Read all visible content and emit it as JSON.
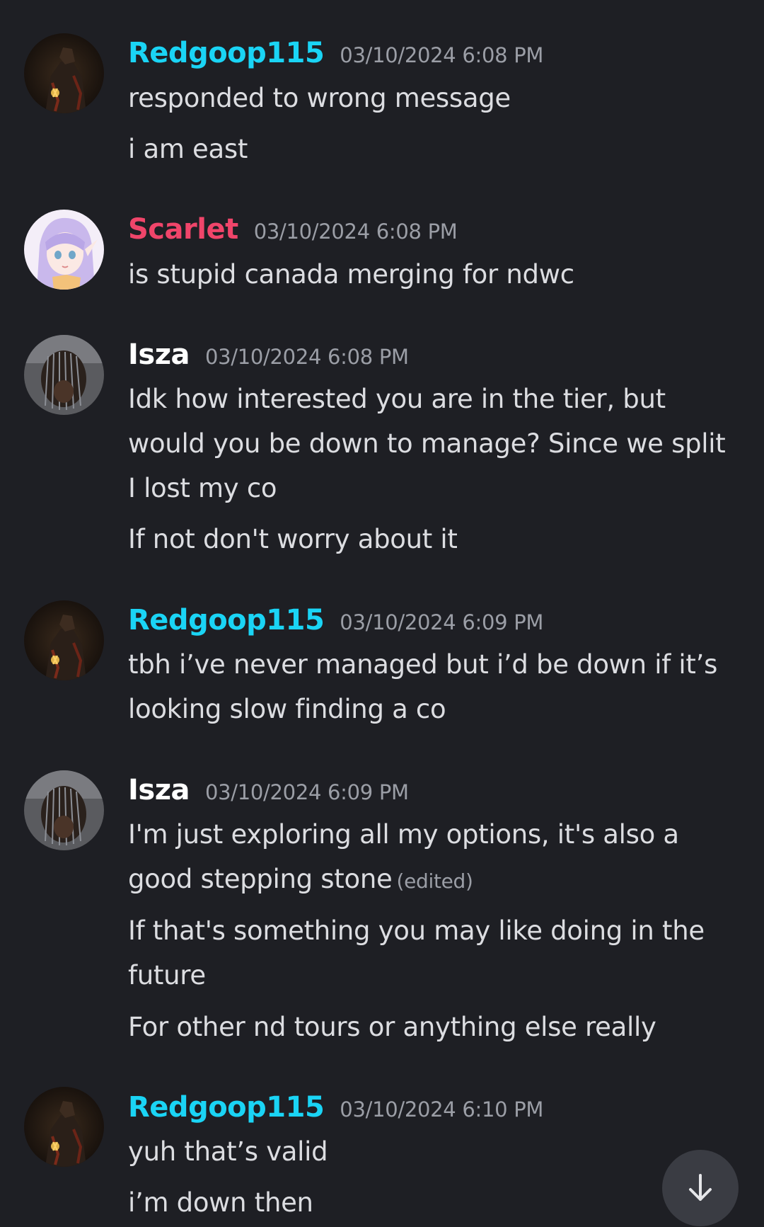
{
  "colors": {
    "background": "#1e1f24",
    "redgoop": "#1ad4f5",
    "scarlet": "#f0456a",
    "isza": "#ffffff",
    "text": "#dcdde1",
    "muted": "#9b9ea6",
    "fab": "#3a3c43"
  },
  "messages": [
    {
      "author": "Redgoop115",
      "timestamp": "03/10/2024 6:08 PM",
      "avatar": "dark-knight-avatar",
      "lines": [
        "responded to wrong message",
        "i am east"
      ]
    },
    {
      "author": "Scarlet",
      "timestamp": "03/10/2024 6:08 PM",
      "avatar": "anime-elf-avatar",
      "lines": [
        "is stupid canada merging for ndwc"
      ]
    },
    {
      "author": "Isza",
      "timestamp": "03/10/2024 6:08 PM",
      "avatar": "braids-avatar",
      "lines": [
        "Idk how interested you are in the tier, but would you be down to manage? Since we split I lost my co",
        "If not don't worry about it"
      ]
    },
    {
      "author": "Redgoop115",
      "timestamp": "03/10/2024 6:09 PM",
      "avatar": "dark-knight-avatar",
      "lines": [
        "tbh i’ve never managed but i’d be down if it’s looking slow finding a co"
      ]
    },
    {
      "author": "Isza",
      "timestamp": "03/10/2024 6:09 PM",
      "avatar": "braids-avatar",
      "lines": [
        "I'm just exploring all my options, it's also a good stepping stone",
        "If that's something you may like doing in the future",
        "For other nd tours or anything else really"
      ],
      "edited_label": "(edited)"
    },
    {
      "author": "Redgoop115",
      "timestamp": "03/10/2024 6:10 PM",
      "avatar": "dark-knight-avatar",
      "lines": [
        "yuh that’s valid",
        "i’m down then"
      ]
    }
  ],
  "scroll_button": {
    "icon": "arrow-down-icon"
  }
}
